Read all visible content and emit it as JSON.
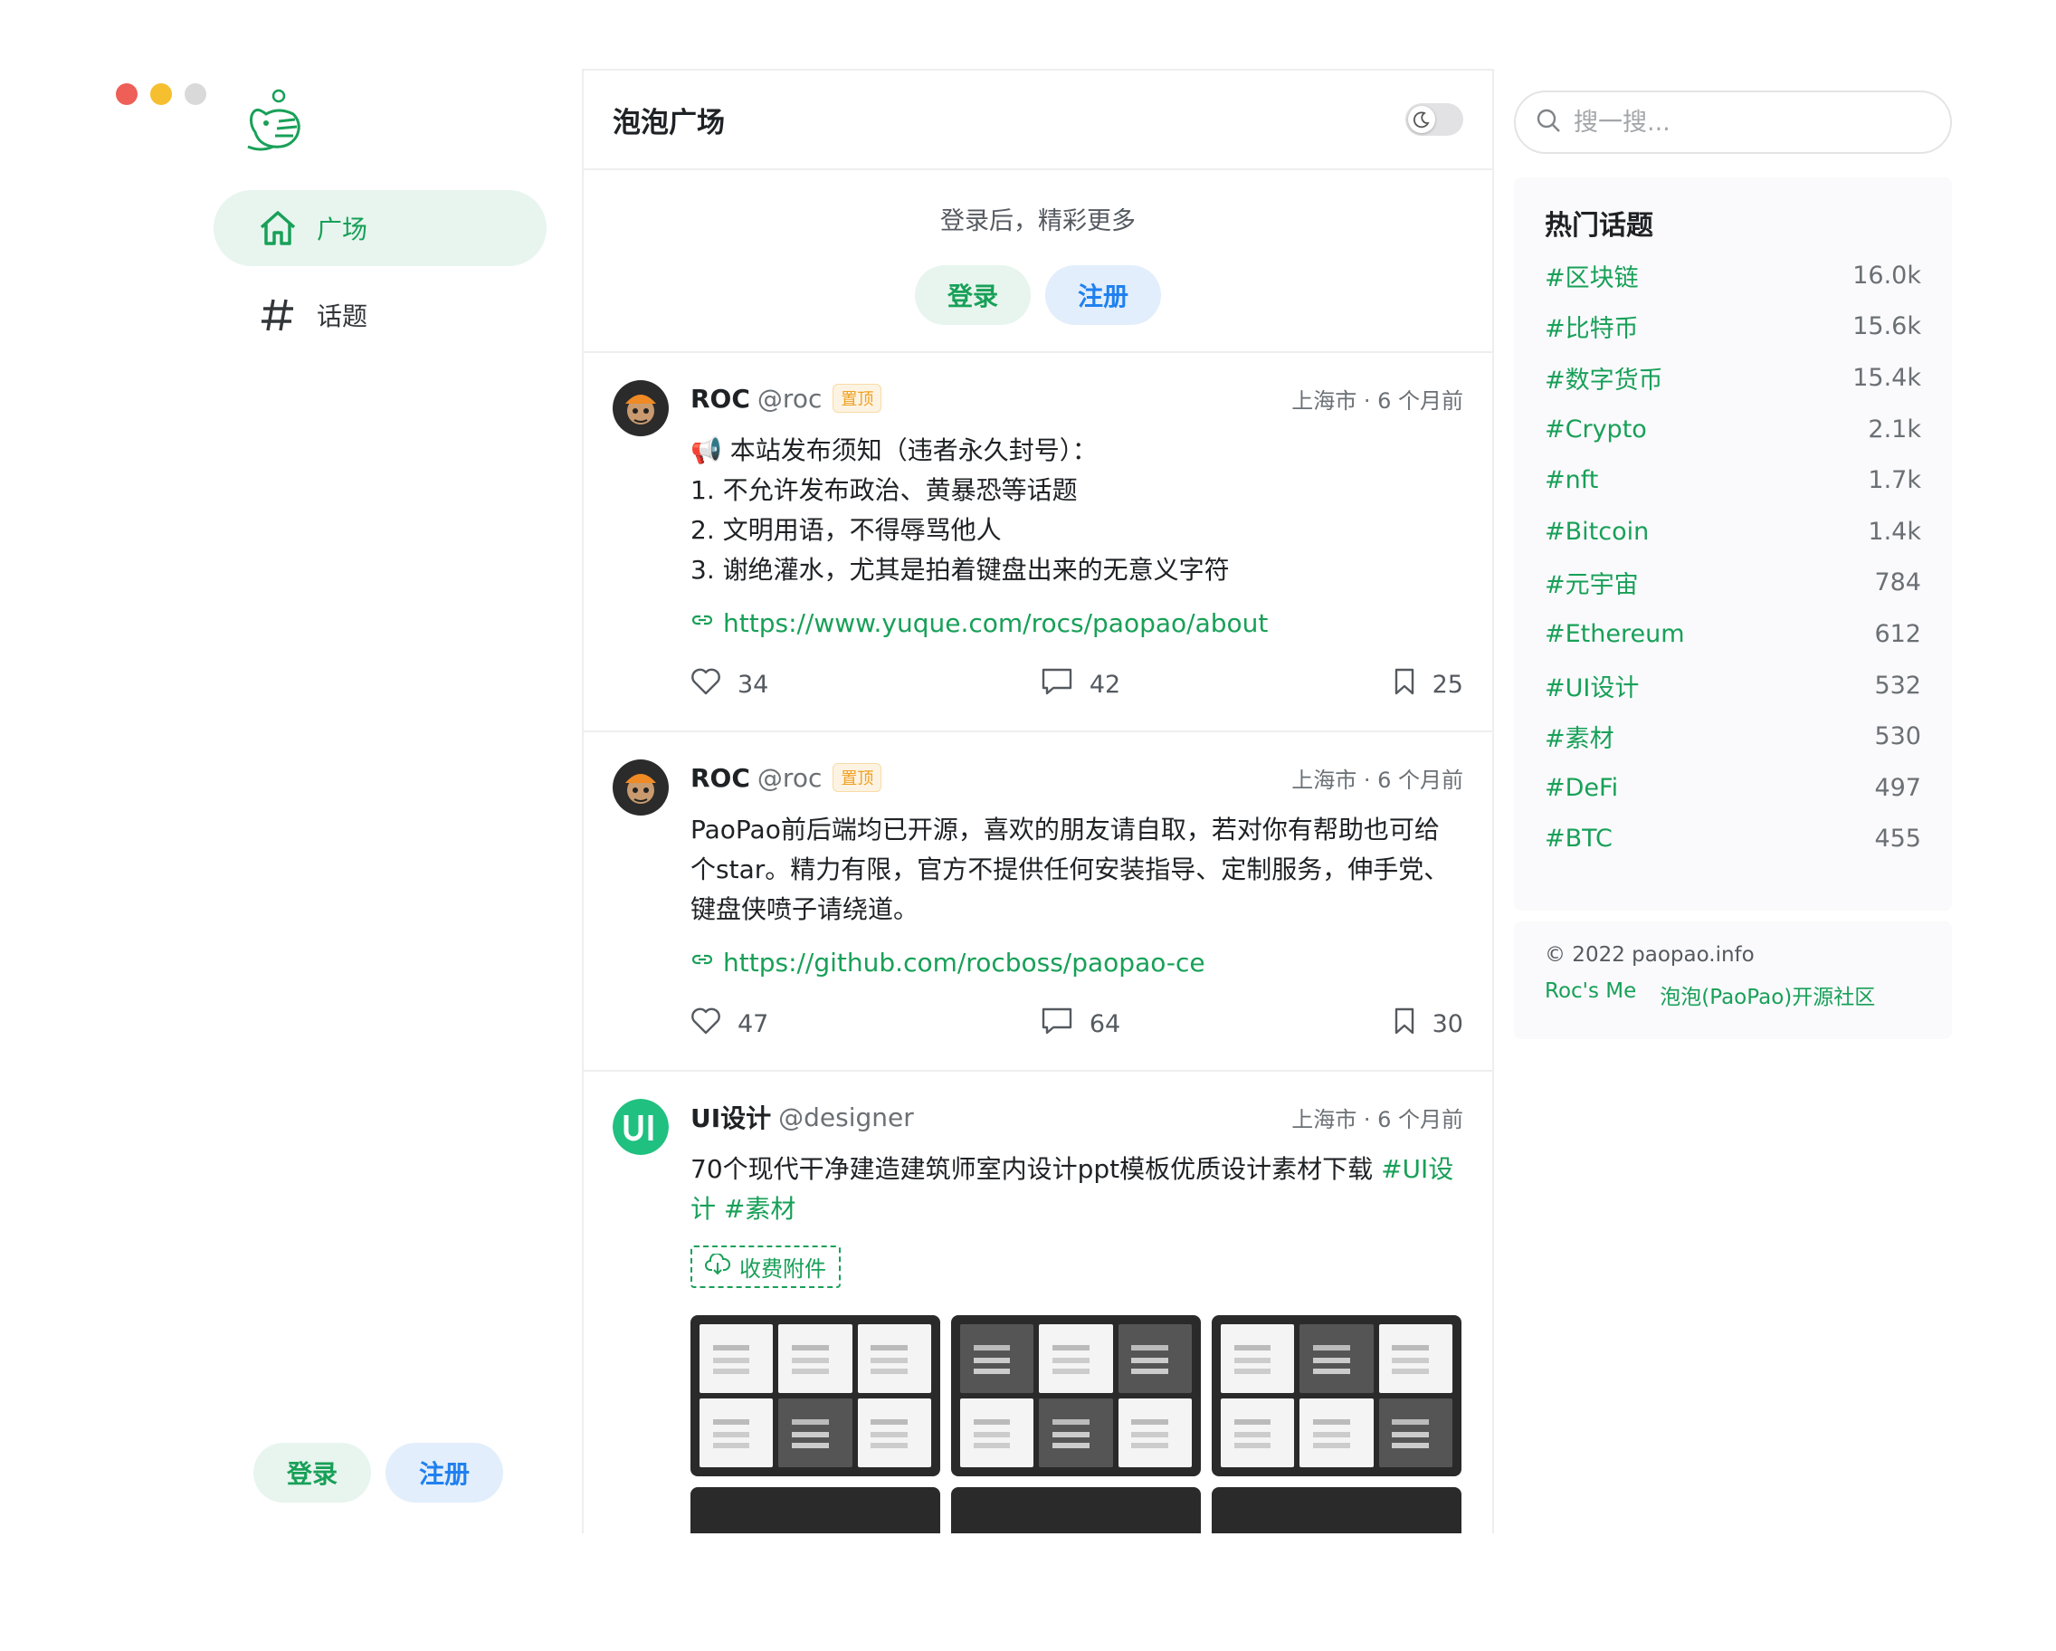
{
  "window": {
    "dot_colors": [
      "#ee5f57",
      "#f5bf2f",
      "#d9d9d9"
    ]
  },
  "sidebar": {
    "items": [
      {
        "label": "广场",
        "icon": "home-icon"
      },
      {
        "label": "话题",
        "icon": "hash-icon"
      }
    ],
    "login_label": "登录",
    "register_label": "注册"
  },
  "main": {
    "title": "泡泡广场",
    "login_hint": "登录后，精彩更多",
    "login_label": "登录",
    "register_label": "注册",
    "posts": [
      {
        "name": "ROC",
        "handle": "@roc",
        "pin": "置顶",
        "meta": "上海市 · 6 个月前",
        "lines": [
          "📢 本站发布须知（违者永久封号）：",
          "1. 不允许发布政治、黄暴恐等话题",
          "2. 文明用语，不得辱骂他人",
          "3. 谢绝灌水，尤其是拍着键盘出来的无意义字符"
        ],
        "link": "https://www.yuque.com/rocs/paopao/about",
        "likes": "34",
        "comments": "42",
        "collects": "25"
      },
      {
        "name": "ROC",
        "handle": "@roc",
        "pin": "置顶",
        "meta": "上海市 · 6 个月前",
        "lines": [
          "PaoPao前后端均已开源，喜欢的朋友请自取，若对你有帮助也可给",
          "个star。精力有限，官方不提供任何安装指导、定制服务，伸手党、",
          "键盘侠喷子请绕道。"
        ],
        "link": "https://github.com/rocboss/paopao-ce",
        "likes": "47",
        "comments": "64",
        "collects": "30"
      },
      {
        "name": "UI设计",
        "handle": "@designer",
        "meta": "上海市 · 6 个月前",
        "text": "70个现代干净建造建筑师室内设计ppt模板优质设计素材下载 ",
        "tag1": "#UI设",
        "tag1b": "计",
        "tag2": "#素材",
        "attachment": "收费附件"
      }
    ]
  },
  "search": {
    "placeholder": "搜一搜..."
  },
  "hot_topics": {
    "title": "热门话题",
    "items": [
      {
        "name": "#区块链",
        "count": "16.0k"
      },
      {
        "name": "#比特币",
        "count": "15.6k"
      },
      {
        "name": "#数字货币",
        "count": "15.4k"
      },
      {
        "name": "#Crypto",
        "count": "2.1k"
      },
      {
        "name": "#nft",
        "count": "1.7k"
      },
      {
        "name": "#Bitcoin",
        "count": "1.4k"
      },
      {
        "name": "#元宇宙",
        "count": "784"
      },
      {
        "name": "#Ethereum",
        "count": "612"
      },
      {
        "name": "#UI设计",
        "count": "532"
      },
      {
        "name": "#素材",
        "count": "530"
      },
      {
        "name": "#DeFi",
        "count": "497"
      },
      {
        "name": "#BTC",
        "count": "455"
      }
    ]
  },
  "footer": {
    "copyright": "© 2022 paopao.info",
    "links": [
      "Roc's Me",
      "泡泡(PaoPao)开源社区"
    ]
  },
  "colors": {
    "accent": "#18a058",
    "info": "#2080f0",
    "pin": "#f0a020"
  }
}
